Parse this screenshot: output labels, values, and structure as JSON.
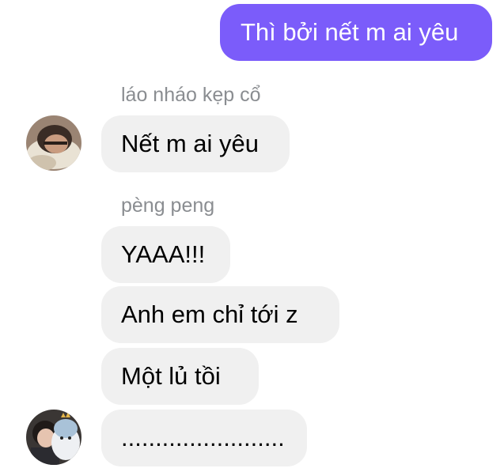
{
  "outgoing": {
    "text": "Thì bởi nết m ai yêu",
    "color": "#7b5cfa"
  },
  "groups": [
    {
      "sender": "láo nháo kẹp cổ",
      "avatar": "user-avatar-photo",
      "messages": [
        "Nết m ai yêu"
      ]
    },
    {
      "sender": "pèng peng",
      "avatar": "user-avatar-photo",
      "messages": [
        "YAAA!!!",
        "Anh em chỉ tới z",
        "Một lủ tồi",
        "........................"
      ]
    }
  ],
  "incoming_bubble_color": "#f0f0f0",
  "sender_name_color": "#8a8d91"
}
